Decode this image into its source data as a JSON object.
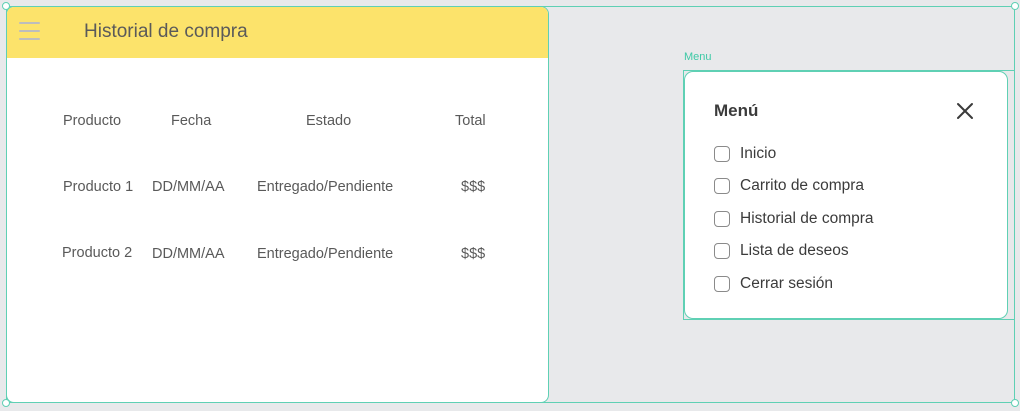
{
  "header": {
    "title": "Historial de compra",
    "menu_icon": "hamburger-icon"
  },
  "table": {
    "headers": [
      "Producto",
      "Fecha",
      "Estado",
      "Total"
    ],
    "rows": [
      [
        "Producto 1",
        "DD/MM/AA",
        "Entregado/Pendiente",
        "$$$"
      ],
      [
        "Producto 2",
        "DD/MM/AA",
        "Entregado/Pendiente",
        "$$$"
      ]
    ]
  },
  "menu": {
    "frame_label": "Menu",
    "title": "Menú",
    "close_icon": "close-icon",
    "items": [
      {
        "label": "Inicio",
        "checked": false
      },
      {
        "label": "Carrito de compra",
        "checked": false
      },
      {
        "label": "Historial de compra",
        "checked": false
      },
      {
        "label": "Lista de deseos",
        "checked": false
      },
      {
        "label": "Cerrar sesión",
        "checked": false
      }
    ]
  },
  "colors": {
    "header_bg": "#fce36b",
    "selection": "#5fd0b4",
    "canvas": "#e8e9eb"
  }
}
